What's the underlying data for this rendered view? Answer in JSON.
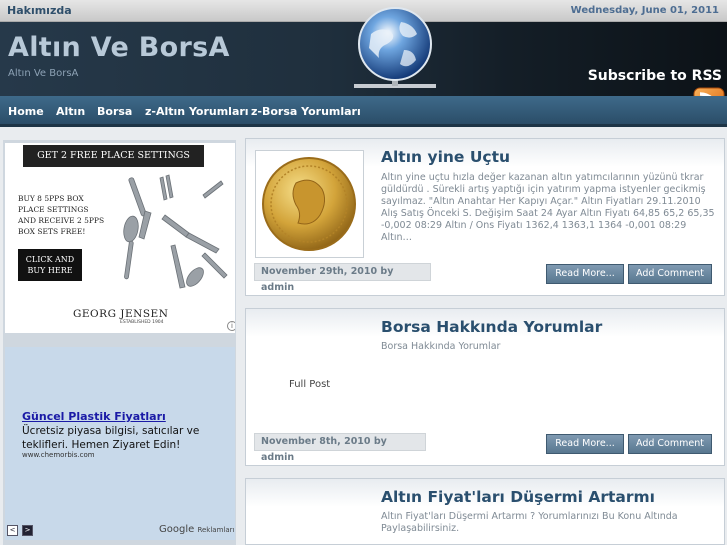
{
  "topbar": {
    "left": "Hakımızda",
    "date": "Wednesday, June 01, 2011"
  },
  "header": {
    "title": "Altın Ve BorsA",
    "subtitle": "Altın Ve BorsA",
    "subscribe": "Subscribe to RSS"
  },
  "nav": {
    "items": [
      "Home",
      "Altın",
      "Borsa",
      "z-Altın Yorumları",
      "z-Borsa Yorumları"
    ]
  },
  "sidebar": {
    "ad1": {
      "banner": "GET 2 FREE PLACE SETTINGS NOW",
      "line1": "BUY 8 5PPS BOX",
      "line2": "PLACE SETTINGS",
      "line3": "AND RECEIVE 2 5PPS",
      "line4": "BOX SETS FREE!",
      "cta1": "CLICK AND",
      "cta2": "BUY HERE",
      "brand": "GEORG JENSEN",
      "brand_sub": "ESTABLISHED 1904",
      "info": "i"
    },
    "ad2": {
      "title": "Güncel Plastik Fiyatları",
      "body": "Ücretsiz piyasa bilgisi, satıcılar ve teklifleri. Hemen Ziyaret Edin!",
      "url": "www.chemorbis.com",
      "prev": "<",
      "next": ">",
      "google": "Google",
      "google_suffix": "Reklamları"
    }
  },
  "posts": [
    {
      "title": "Altın yine Uçtu",
      "excerpt": "Altın yine uçtu hızla değer kazanan altın yatımcılarının yüzünü tkrar güldürdü . Sürekli artış yaptığı için yatırım yapma istyenler gecikmiş sayılmaz. \"Altın Anahtar Her Kapıyı Açar.\" Altın Fiyatları 29.11.2010 Alış Satış Önceki S. Değişim Saat 24 Ayar Altın Fiyatı 64,85 65,2 65,35 -0,002 08:29 Altın / Ons Fiyatı 1362,4 1363,1 1364 -0,001 08:29 Altın…",
      "meta": "November 29th, 2010 by admin",
      "read_more": "Read More...",
      "add_comment": "Add Comment"
    },
    {
      "title": "Borsa Hakkında Yorumlar",
      "excerpt": "Borsa Hakkında Yorumlar",
      "full_post": "Full Post",
      "meta": "November 8th, 2010 by admin",
      "read_more": "Read More...",
      "add_comment": "Add Comment"
    },
    {
      "title": "Altın Fiyat'ları Düşermi Artarmı",
      "excerpt": "Altın Fiyat'ları Düşermi Artarmı ? Yorumlarınızı Bu Konu Altında Paylaşabilirsiniz."
    }
  ],
  "colors": {
    "accent": "#2a4f6e",
    "nav": "#3e6a8a",
    "header": "#1f2f3d",
    "button": "#6b879f"
  }
}
